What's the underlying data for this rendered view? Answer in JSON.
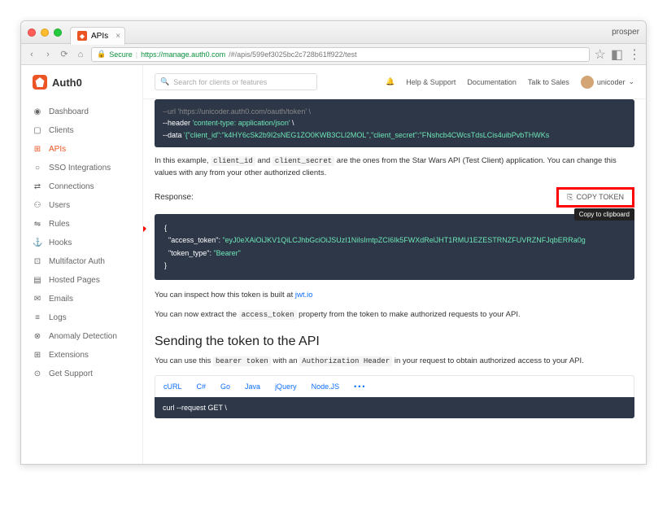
{
  "browser": {
    "tab_title": "APIs",
    "profile": "prosper",
    "secure_label": "Secure",
    "url_host": "https://manage.auth0.com",
    "url_path": "/#/apis/599ef3025bc2c728b61ff922/test"
  },
  "logo_text": "Auth0",
  "sidebar": {
    "items": [
      {
        "icon": "◉",
        "label": "Dashboard"
      },
      {
        "icon": "▢",
        "label": "Clients"
      },
      {
        "icon": "⊞",
        "label": "APIs"
      },
      {
        "icon": "○",
        "label": "SSO Integrations"
      },
      {
        "icon": "⇄",
        "label": "Connections"
      },
      {
        "icon": "⚇",
        "label": "Users"
      },
      {
        "icon": "⇋",
        "label": "Rules"
      },
      {
        "icon": "⚓",
        "label": "Hooks"
      },
      {
        "icon": "⊡",
        "label": "Multifactor Auth"
      },
      {
        "icon": "▤",
        "label": "Hosted Pages"
      },
      {
        "icon": "✉",
        "label": "Emails"
      },
      {
        "icon": "≡",
        "label": "Logs"
      },
      {
        "icon": "⊗",
        "label": "Anomaly Detection"
      },
      {
        "icon": "⊞",
        "label": "Extensions"
      },
      {
        "icon": "⊙",
        "label": "Get Support"
      }
    ]
  },
  "topbar": {
    "search_placeholder": "Search for clients or features",
    "links": [
      "Help & Support",
      "Documentation",
      "Talk to Sales"
    ],
    "username": "unicoder"
  },
  "code1": {
    "l1": "--url 'https://unicoder.auth0.com/oauth/token' \\",
    "l2a": "--header ",
    "l2b": "'content-type: application/json'",
    "l2c": " \\",
    "l3a": "--data ",
    "l3b": "'{\"client_id\":\"k4HY6cSk2b9I2sNEG1ZO0KWB3CLl2MOL\",\"client_secret\":\"FNshcb4CWcsTdsLCis4uibPvbTHWKs"
  },
  "para1": {
    "pre": "In this example, ",
    "c1": "client_id",
    "mid": " and ",
    "c2": "client_secret",
    "post": " are the ones from the Star Wars API (Test Client) application. You can change this values with any from your other authorized clients."
  },
  "resp_label": "Response:",
  "copy_btn": "COPY TOKEN",
  "tooltip": "Copy to clipboard",
  "code2": {
    "open": "{",
    "k1": "\"access_token\"",
    "v1": "\"eyJ0eXAiOiJKV1QiLCJhbGciOiJSUzI1NiIsImtpZCI6Ik5FWXdRelJHT1RMU1EZESTRNZFUVRZNFJqbERRa0g",
    "k2": "\"token_type\"",
    "v2": "\"Bearer\"",
    "close": "}"
  },
  "para2": {
    "pre": "You can inspect how this token is built at ",
    "link": "jwt.io"
  },
  "para3": {
    "pre": "You can now extract the ",
    "c1": "access_token",
    "post": " property from the token to make authorized requests to your API."
  },
  "h2": "Sending the token to the API",
  "para4": {
    "pre": "You can use this ",
    "c1": "bearer token",
    "mid": " with an ",
    "c2": "Authorization Header",
    "post": " in your request to obtain authorized access to your API."
  },
  "tabs": [
    "cURL",
    "C#",
    "Go",
    "Java",
    "jQuery",
    "Node.JS"
  ],
  "tabs_more": "•••",
  "code3": "curl --request GET \\"
}
